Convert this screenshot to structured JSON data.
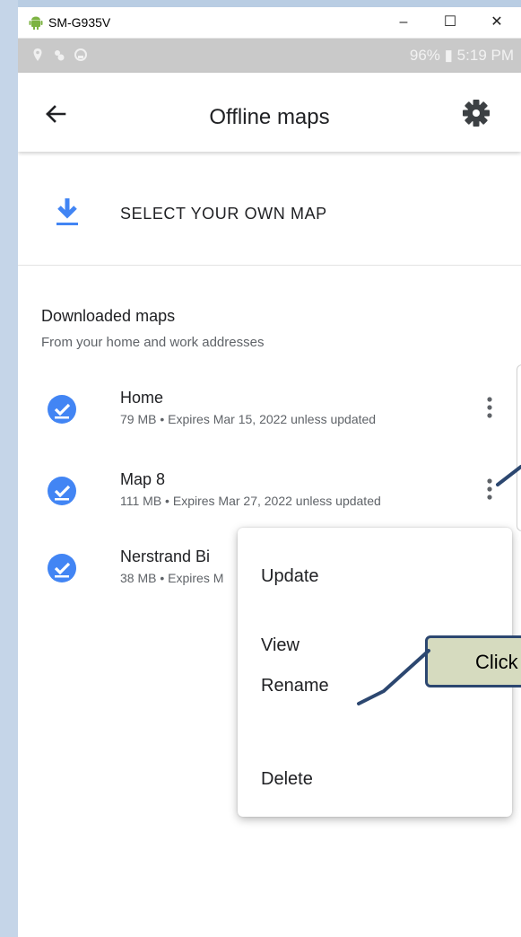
{
  "window": {
    "title": "SM-G935V",
    "controls": [
      "–",
      "☐",
      "✕"
    ]
  },
  "statusbar": {
    "battery_time": "96% ▮ 5:19 PM"
  },
  "appbar": {
    "title": "Offline maps"
  },
  "select_own_map": {
    "label": "SELECT YOUR OWN MAP"
  },
  "section": {
    "title": "Downloaded maps",
    "subtitle": "From your home and work addresses"
  },
  "maps": [
    {
      "name": "Home",
      "meta": "79 MB • Expires Mar 15, 2022 unless updated"
    },
    {
      "name": "Map 8",
      "meta": "111 MB • Expires Mar 27, 2022 unless updated"
    },
    {
      "name": "Nerstrand Bi",
      "meta": "38 MB • Expires M"
    }
  ],
  "menu": {
    "items": [
      "Update",
      "View",
      "Rename",
      "Delete"
    ]
  },
  "callout": {
    "text": "Click"
  },
  "colors": {
    "accent_blue": "#4285f4",
    "callout_bg": "#d6dbbf",
    "callout_border": "#2c4770"
  }
}
